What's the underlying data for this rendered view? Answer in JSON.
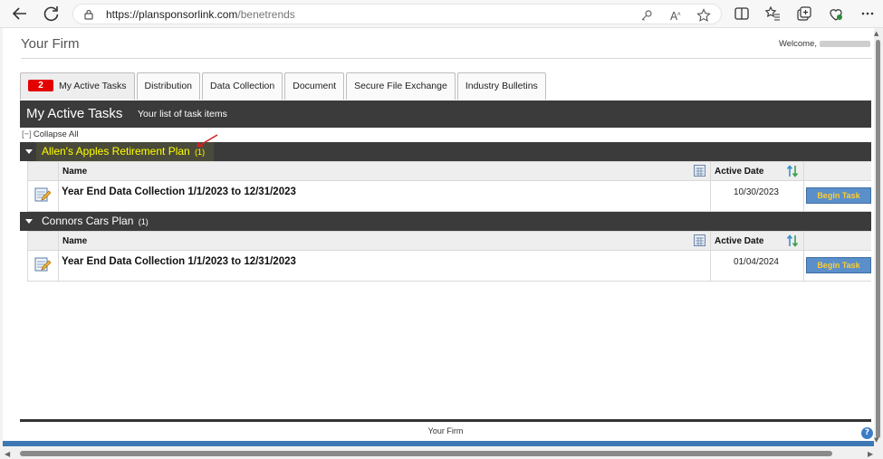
{
  "browser": {
    "url_host": "https://plansponsorlink.com",
    "url_path": "/benetrends"
  },
  "page": {
    "firm_title": "Your Firm",
    "welcome_label": "Welcome,"
  },
  "tabs": [
    {
      "label": "My Active Tasks",
      "badge": "2",
      "active": true
    },
    {
      "label": "Distribution"
    },
    {
      "label": "Data Collection"
    },
    {
      "label": "Document"
    },
    {
      "label": "Secure File Exchange"
    },
    {
      "label": "Industry Bulletins"
    }
  ],
  "header": {
    "title": "My Active Tasks",
    "subtitle": "Your list of task items"
  },
  "collapse": {
    "mark": "[−]",
    "label": "Collapse All"
  },
  "columns": {
    "name": "Name",
    "active_date": "Active Date"
  },
  "plans": [
    {
      "name": "Allen's Apples Retirement Plan",
      "count": "(1)",
      "highlighted": true,
      "tasks": [
        {
          "name": "Year End Data Collection 1/1/2023 to 12/31/2023",
          "date": "10/30/2023",
          "button": "Begin Task"
        }
      ]
    },
    {
      "name": "Connors Cars Plan",
      "count": "(1)",
      "highlighted": false,
      "tasks": [
        {
          "name": "Year End Data Collection 1/1/2023 to 12/31/2023",
          "date": "01/04/2024",
          "button": "Begin Task"
        }
      ]
    }
  ],
  "footer": {
    "text": "Your Firm",
    "help": "?"
  },
  "colors": {
    "header_band": "#3b3b3b",
    "badge": "#e30000",
    "highlight_text": "#ffff00",
    "button": "#5a8fc9",
    "button_text": "#ffcc33"
  }
}
